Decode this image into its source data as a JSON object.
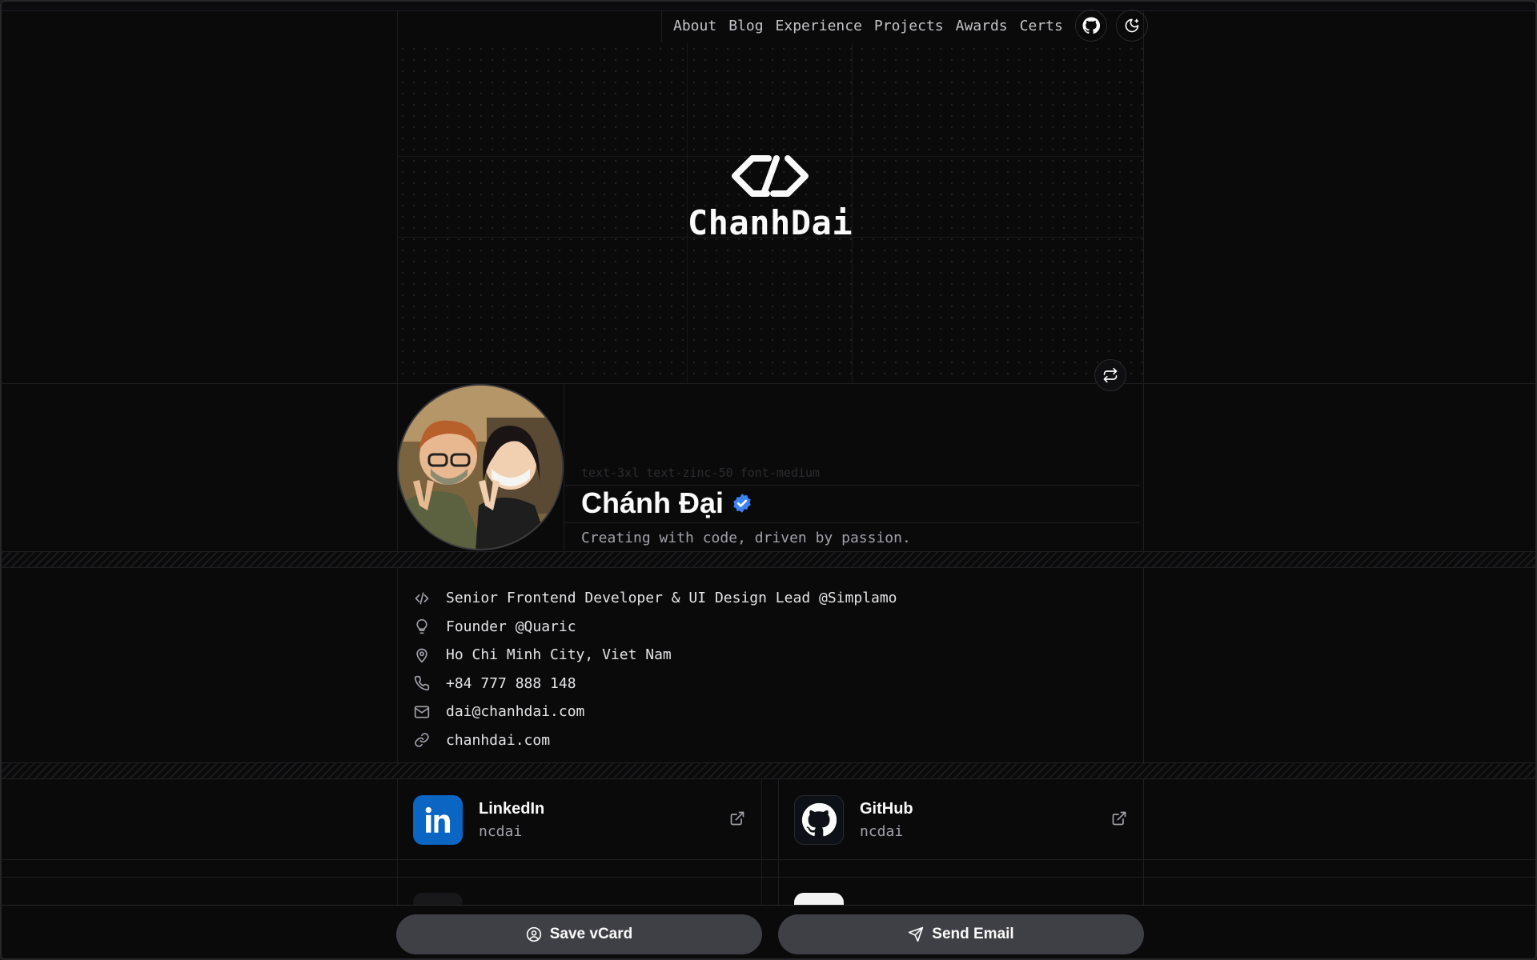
{
  "nav": {
    "links": [
      "About",
      "Blog",
      "Experience",
      "Projects",
      "Awards",
      "Certs"
    ],
    "github_icon": "github-icon",
    "theme_icon": "moon-icon"
  },
  "hero": {
    "logo_text": "ChanhDai",
    "swap_icon": "repeat-icon"
  },
  "profile": {
    "ghost_text": "text-3xl text-zinc-50 font-medium",
    "name": "Chánh Đại",
    "verified_icon": "verified-badge-icon",
    "tagline": "Creating with code, driven by passion."
  },
  "info": [
    {
      "icon": "code-icon",
      "text": "Senior Frontend Developer & UI Design Lead @Simplamo"
    },
    {
      "icon": "lightbulb-icon",
      "text": "Founder @Quaric"
    },
    {
      "icon": "map-pin-icon",
      "text": "Ho Chi Minh City, Viet Nam"
    },
    {
      "icon": "phone-icon",
      "text": "+84 777 888 148"
    },
    {
      "icon": "mail-icon",
      "text": "dai@chanhdai.com"
    },
    {
      "icon": "link-icon",
      "text": "chanhdai.com"
    }
  ],
  "socials": [
    {
      "name": "LinkedIn",
      "handle": "ncdai",
      "color": "#0a66c2"
    },
    {
      "name": "GitHub",
      "handle": "ncdai",
      "color": "#0d1117"
    }
  ],
  "bottom": {
    "save_label": "Save vCard",
    "email_label": "Send Email"
  },
  "colors": {
    "background": "#0a0a0b",
    "verified": "#3b82f6",
    "button": "#3f3f46"
  }
}
